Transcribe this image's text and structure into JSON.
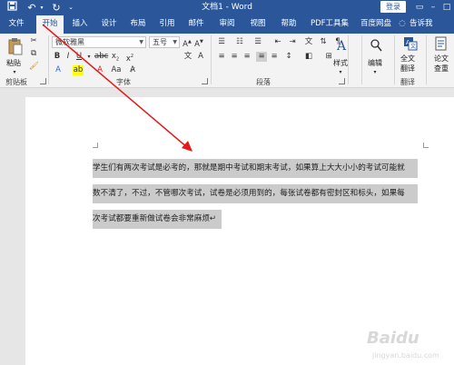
{
  "titlebar": {
    "title": "文档1 - Word",
    "login": "登录"
  },
  "tabs": [
    {
      "label": "文件"
    },
    {
      "label": "开始"
    },
    {
      "label": "插入"
    },
    {
      "label": "设计"
    },
    {
      "label": "布局"
    },
    {
      "label": "引用"
    },
    {
      "label": "邮件"
    },
    {
      "label": "审阅"
    },
    {
      "label": "视图"
    },
    {
      "label": "帮助"
    },
    {
      "label": "PDF工具集"
    },
    {
      "label": "百度网盘"
    }
  ],
  "tell_me": "告诉我",
  "ribbon": {
    "clipboard": {
      "paste": "粘贴",
      "group": "剪贴板"
    },
    "font": {
      "name": "微软雅黑",
      "size": "五号",
      "group": "字体"
    },
    "paragraph": {
      "group": "段落"
    },
    "styles": {
      "label": "样式"
    },
    "editing": {
      "label": "编辑"
    },
    "translate": {
      "line1": "全文",
      "line2": "翻译",
      "group": "翻译"
    },
    "paper_check": {
      "line1": "论文",
      "line2": "查重"
    }
  },
  "document": {
    "lines": [
      "学生们有两次考试是必考的，那就是期中考试和期末考试，如果算上大大小小的考试可能就",
      "数不清了，不过，不管哪次考试，试卷是必须用到的，每张试卷都有密封区和标头，如果每",
      "次考试都要重新做试卷会非常麻烦↵"
    ]
  },
  "colors": {
    "title_bar": "#2b579a",
    "ribbon_bg": "#f3f3f3",
    "selection": "#cbcbcb",
    "arrow": "#e31b1b"
  }
}
